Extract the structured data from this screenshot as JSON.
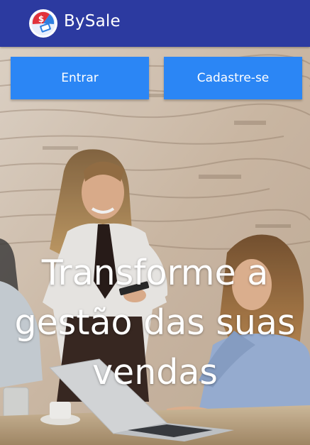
{
  "app": {
    "title": "BySale",
    "logo_icon": "bysale-logo-icon"
  },
  "actions": {
    "login_label": "Entrar",
    "signup_label": "Cadastre-se"
  },
  "hero": {
    "headline_lines": [
      "Transforme a",
      "gestão das suas",
      "vendas"
    ]
  },
  "colors": {
    "appbar": "#2c3aa0",
    "button": "#2b86f5",
    "text": "#ffffff"
  }
}
